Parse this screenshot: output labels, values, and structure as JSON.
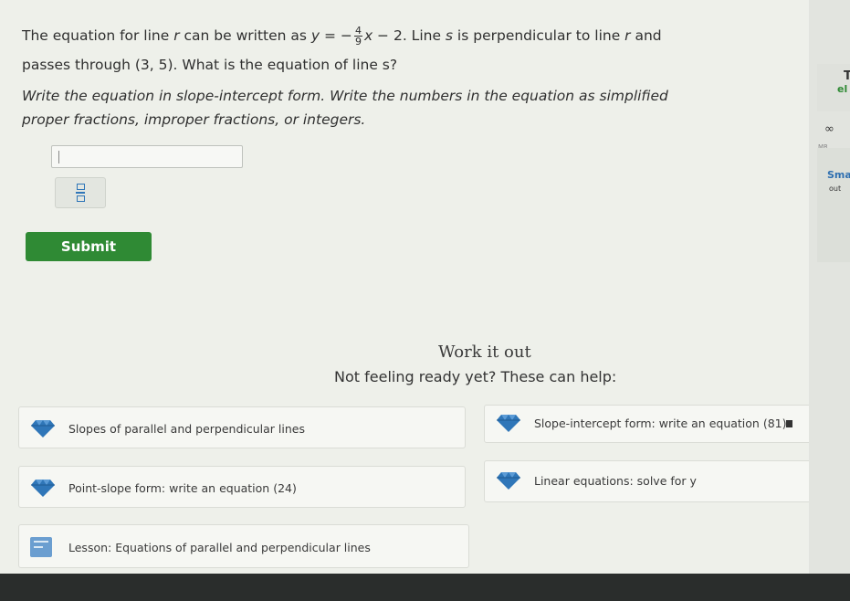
{
  "question": {
    "line1_prefix": "The equation for line ",
    "line_r": "r",
    "line1_mid": " can be written as ",
    "eq_y": "y",
    "eq_equals": " = −",
    "eq_num": "4",
    "eq_den": "9",
    "eq_x": "x",
    "eq_const": " − 2",
    "line1_suffix_a": ". Line ",
    "line_s": "s",
    "line1_suffix_b": " is perpendicular to line ",
    "line_r2": "r",
    "line1_suffix_c": " and",
    "line2": "passes through (3, 5). What is the equation of line s?",
    "instruction1": "Write the equation in slope-intercept form. Write the numbers in the equation as simplified",
    "instruction2": "proper fractions, improper fractions, or integers."
  },
  "answer_input": {
    "value": ""
  },
  "fraction_button": {
    "icon": "fraction-icon"
  },
  "submit": {
    "label": "Submit"
  },
  "work_it_out": {
    "title": "Work it out",
    "subtitle": "Not feeling ready yet? These can help:"
  },
  "help_cards": [
    {
      "label": "Slopes of parallel and perpendicular lines",
      "icon": "gem-icon"
    },
    {
      "label": "Slope-intercept form: write an equation (81)",
      "icon": "gem-icon"
    },
    {
      "label": "Point-slope form: write an equation (24)",
      "icon": "gem-icon"
    },
    {
      "label": "Linear equations: solve for y",
      "icon": "gem-icon"
    },
    {
      "label": "Lesson: Equations of parallel and perpendicular lines",
      "icon": "lesson-icon"
    }
  ],
  "sidebar": {
    "t": "T",
    "el": "el",
    "inf": "∞",
    "mr": "MR",
    "sm": "Sma",
    "out": "out"
  },
  "colors": {
    "submit_green": "#2f8a34",
    "gem_blue": "#2f76b8",
    "page_bg": "#eef0ea"
  }
}
